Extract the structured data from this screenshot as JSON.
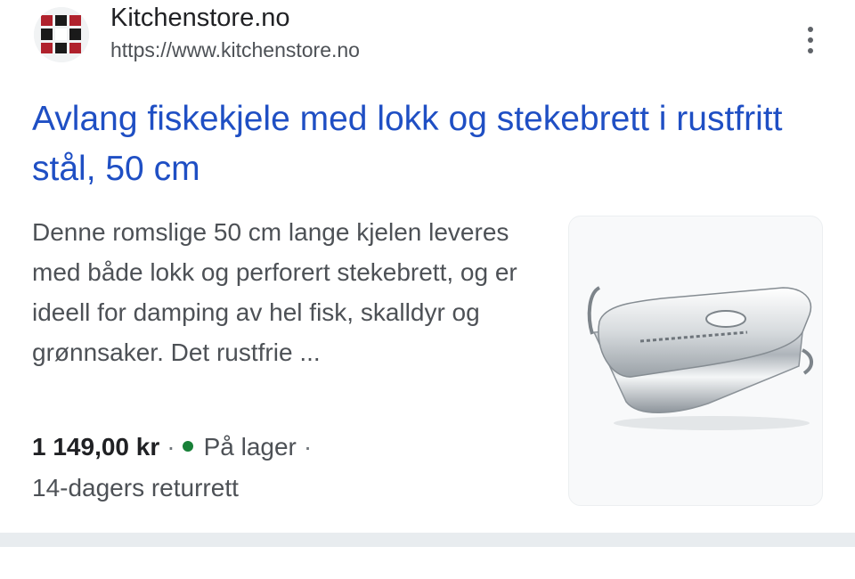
{
  "result": {
    "site_name": "Kitchenstore.no",
    "site_url": "https://www.kitchenstore.no",
    "title": "Avlang fiskekjele med lokk og stekebrett i rustfritt stål, 50 cm",
    "snippet": "Denne romslige 50 cm lange kjelen leveres med både lokk og perforert stekebrett, og er ideell for damping av hel fisk, skalldyr og grønnsaker. Det rustfrie ...",
    "price": "1 149,00 kr",
    "separator": "·",
    "stock": "På lager",
    "returns": "14-dagers returrett",
    "stock_color": "#188038",
    "title_color": "#1f4fc4",
    "favicon_colors": [
      "#b0222d",
      "#1a1a1a"
    ],
    "icons": {
      "favicon": "kitchenstore-logo-icon",
      "more": "more-vert-icon"
    }
  }
}
